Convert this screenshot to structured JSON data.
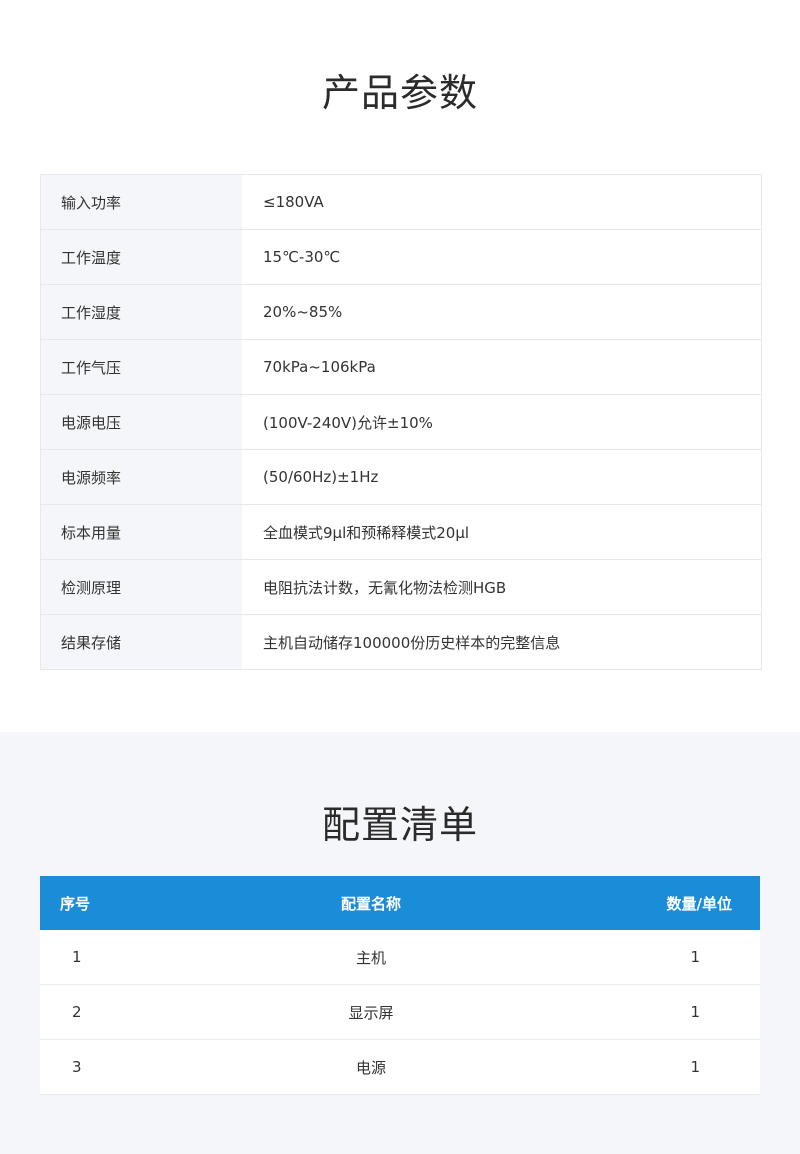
{
  "specs": {
    "title": "产品参数",
    "rows": [
      {
        "label": "输入功率",
        "value": "≤180VA"
      },
      {
        "label": "工作温度",
        "value": "15℃-30℃"
      },
      {
        "label": "工作湿度",
        "value": "20%~85%"
      },
      {
        "label": "工作气压",
        "value": "70kPa~106kPa"
      },
      {
        "label": "电源电压",
        "value": "(100V-240V)允许±10%"
      },
      {
        "label": "电源频率",
        "value": "(50/60Hz)±1Hz"
      },
      {
        "label": "标本用量",
        "value": "全血模式9μl和预稀释模式20μl"
      },
      {
        "label": "检测原理",
        "value": "电阻抗法计数，无氰化物法检测HGB"
      },
      {
        "label": "结果存储",
        "value": "主机自动储存100000份历史样本的完整信息"
      }
    ]
  },
  "config": {
    "title": "配置清单",
    "header": {
      "index": "序号",
      "name": "配置名称",
      "qty": "数量/单位"
    },
    "rows": [
      {
        "index": "1",
        "name": "主机",
        "qty": "1"
      },
      {
        "index": "2",
        "name": "显示屏",
        "qty": "1"
      },
      {
        "index": "3",
        "name": "电源",
        "qty": "1"
      }
    ]
  },
  "colors": {
    "header_blue": "#1a8cd8",
    "label_bg": "#f5f6f9",
    "section_bg": "#f4f6f9"
  }
}
